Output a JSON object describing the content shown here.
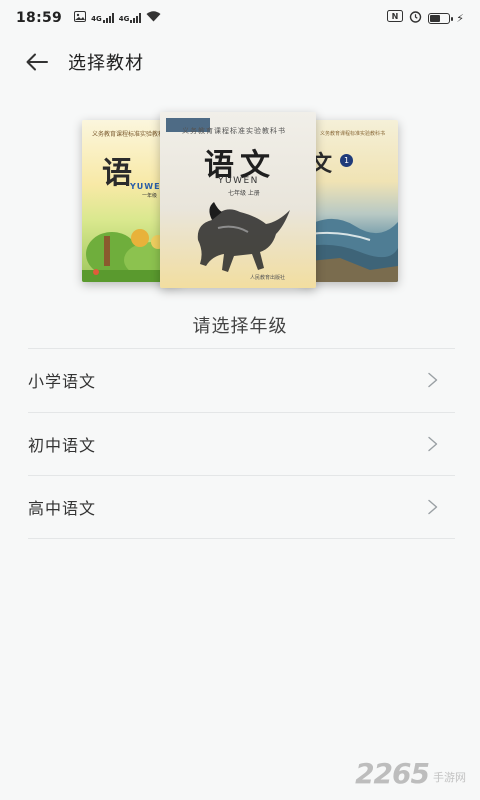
{
  "status_bar": {
    "time": "18:59",
    "network_1": "4G",
    "network_2": "4G"
  },
  "header": {
    "title": "选择教材"
  },
  "books": {
    "left": {
      "title": "语",
      "subtitle": "YUWEN",
      "grade": "一年级"
    },
    "center": {
      "series": "义务教育课程标准实验教科书",
      "title": "语文",
      "subtitle": "YUWEN",
      "grade": "七年级 上册"
    },
    "right": {
      "title": "文",
      "volume": "1"
    }
  },
  "section": {
    "title": "请选择年级"
  },
  "grades": [
    {
      "label": "小学语文"
    },
    {
      "label": "初中语文"
    },
    {
      "label": "高中语文"
    }
  ],
  "watermark": {
    "number": "2265",
    "text": "手游网"
  }
}
